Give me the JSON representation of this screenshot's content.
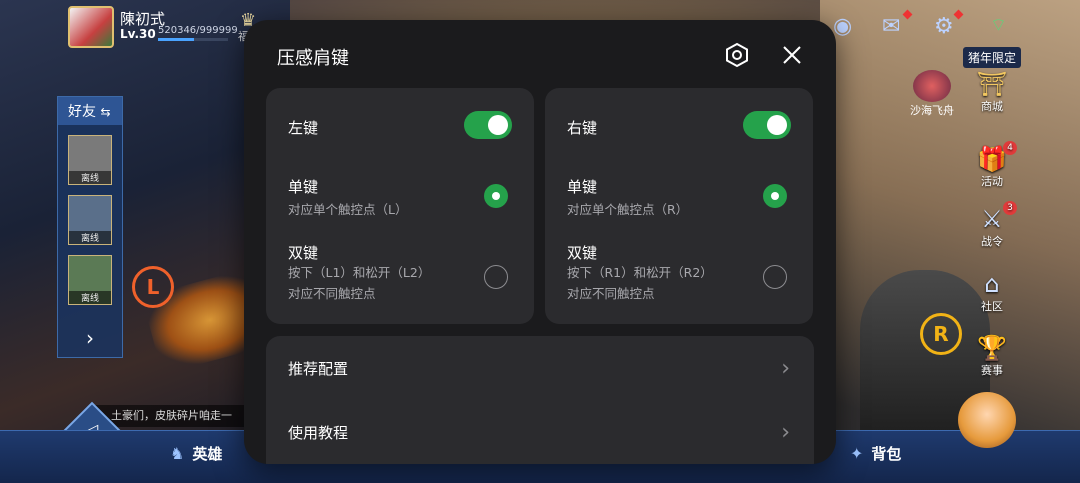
{
  "player": {
    "name": "陳初式",
    "level": "Lv.30",
    "exp": "520346/999999",
    "exp_fraction": 0.52,
    "fu_label": "福"
  },
  "friends_panel": {
    "title": "好友",
    "offline_label": "离线"
  },
  "right_menu": {
    "pig_label": "猪年限定",
    "shamo_label": "沙海飞舟",
    "shop": "商城",
    "activity": "活动",
    "activity_badge": "4",
    "battle_pass": "战令",
    "battle_pass_badge": "3",
    "community": "社区",
    "events": "赛事"
  },
  "markers": {
    "left": "L",
    "right": "R"
  },
  "chat_text": "土豪们，皮肤碎片咱走一",
  "bottom_bar": {
    "hero": "英雄",
    "bag": "背包"
  },
  "dialog": {
    "title": "压感肩键",
    "left_card": {
      "title": "左键",
      "toggle_on": true,
      "single_title": "单键",
      "single_desc": "对应单个触控点（L）",
      "single_selected": true,
      "double_title": "双键",
      "double_desc_1": "按下（L1）和松开（L2）",
      "double_desc_2": "对应不同触控点",
      "double_selected": false
    },
    "right_card": {
      "title": "右键",
      "toggle_on": true,
      "single_title": "单键",
      "single_desc": "对应单个触控点（R）",
      "single_selected": true,
      "double_title": "双键",
      "double_desc_1": "按下（R1）和松开（R2）",
      "double_desc_2": "对应不同触控点",
      "double_selected": false
    },
    "list": [
      {
        "label": "推荐配置"
      },
      {
        "label": "使用教程"
      }
    ]
  },
  "colors": {
    "accent_green": "#25a24b",
    "dialog_bg": "#1b1b1d",
    "card_bg": "#2b2b2e"
  }
}
